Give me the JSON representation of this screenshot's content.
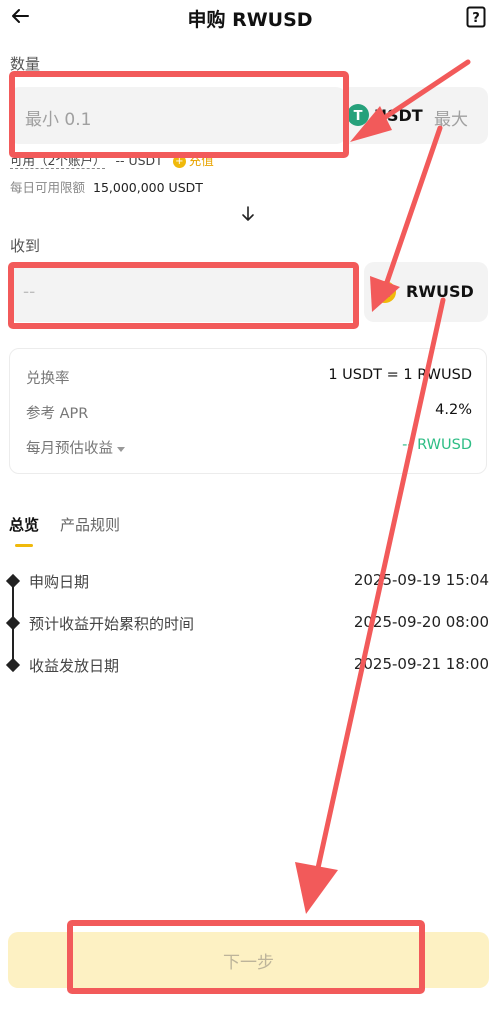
{
  "header": {
    "title": "申购 RWUSD"
  },
  "amount": {
    "label": "数量",
    "placeholder": "最小 0.1",
    "coin": "USDT",
    "max_label": "最大",
    "available_label": "可用（2个账户）",
    "available_value": "-- USDT",
    "recharge_label": "充值",
    "limit_label": "每日可用限额",
    "limit_value": "15,000,000 USDT"
  },
  "receive": {
    "label": "收到",
    "placeholder": "--",
    "coin": "RWUSD"
  },
  "info": {
    "rate_label": "兑换率",
    "rate_value": "1 USDT = 1 RWUSD",
    "apr_label": "参考 APR",
    "apr_value": "4.2%",
    "monthly_label": "每月预估收益",
    "monthly_value": "-- RWUSD"
  },
  "tabs": [
    {
      "label": "总览"
    },
    {
      "label": "产品规则"
    }
  ],
  "timeline": [
    {
      "label": "申购日期",
      "value": "2025-09-19 15:04"
    },
    {
      "label": "预计收益开始累积的时间",
      "value": "2025-09-20 08:00"
    },
    {
      "label": "收益发放日期",
      "value": "2025-09-21 18:00"
    }
  ],
  "footer": {
    "next_label": "下一步"
  },
  "colors": {
    "accent": "#f0b90b",
    "green": "#2ebd85",
    "annotation": "#f25a5a"
  }
}
